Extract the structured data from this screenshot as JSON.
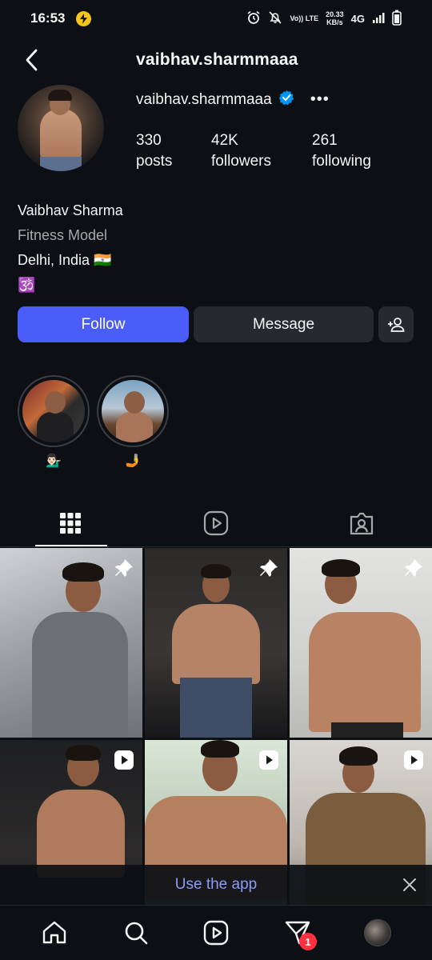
{
  "status_bar": {
    "time": "16:53",
    "net_speed": "20.33",
    "net_unit": "KB/s",
    "volte_label": "Vo)) LTE",
    "network": "4G"
  },
  "header": {
    "title": "vaibhav.sharmmaaa"
  },
  "profile": {
    "username": "vaibhav.sharmmaaa",
    "verified": true,
    "stats": [
      {
        "value": "330",
        "label": "posts"
      },
      {
        "value": "42K",
        "label": "followers"
      },
      {
        "value": "261",
        "label": "following"
      }
    ],
    "name": "Vaibhav Sharma",
    "category": "Fitness Model",
    "location": "Delhi, India 🇮🇳",
    "bio_extra": "🕉️"
  },
  "actions": {
    "follow": "Follow",
    "message": "Message"
  },
  "highlights": [
    {
      "label": "💁🏻‍♂️"
    },
    {
      "label": "🤳"
    }
  ],
  "bottom_banner": {
    "use_app": "Use the app"
  },
  "bottom_nav": {
    "notification_count": "1"
  },
  "colors": {
    "background": "#0c1014",
    "follow_button": "#4a5df9",
    "secondary_button": "#262a2f",
    "verified_badge": "#0095f6",
    "link": "#8b9bf8",
    "badge_red": "#ff3040"
  }
}
